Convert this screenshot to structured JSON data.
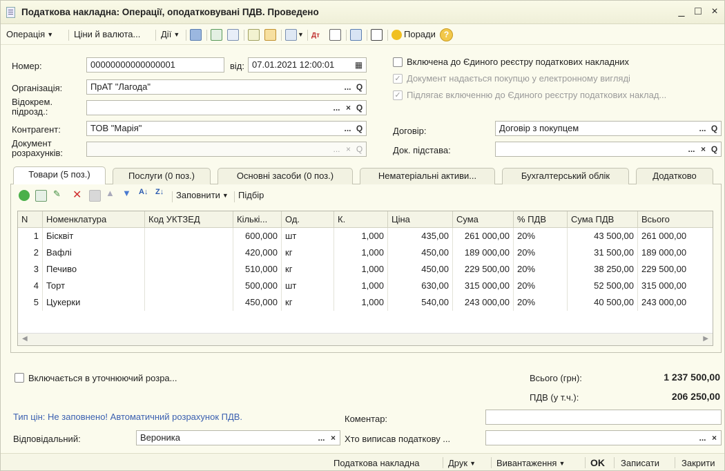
{
  "window": {
    "title": "Податкова накладна: Операції, оподатковувані ПДВ. Проведено",
    "minimize": "_",
    "maximize": "□",
    "close": "×"
  },
  "toolbar": {
    "operation": "Операція",
    "prices": "Ціни й валюта...",
    "actions": "Дії",
    "tips": "Поради",
    "help": "?"
  },
  "form": {
    "number_label": "Номер:",
    "number_value": "00000000000000001",
    "date_label": "від:",
    "date_value": "07.01.2021 12:00:01",
    "org_label": "Організація:",
    "org_value": "ПрАТ \"Лагода\"",
    "division_label": "Відокрем. підрозд.:",
    "division_value": "",
    "counterparty_label": "Контрагент:",
    "counterparty_value": "ТОВ \"Марія\"",
    "settlement_label": "Документ розрахунків:",
    "settlement_value": "",
    "reg_check_label": "Включена до Єдиного реєстру податкових накладних",
    "electronic_label": "Документ надається покупцю у електронному вигляді",
    "subject_label": "Підлягає включенню до Єдиного реєстру податкових наклад...",
    "contract_label": "Договір:",
    "contract_value": "Договір з покупцем",
    "basis_label": "Док. підстава:",
    "basis_value": ""
  },
  "tabs": [
    {
      "label": "Товари (5 поз.)"
    },
    {
      "label": "Послуги (0 поз.)"
    },
    {
      "label": "Основні засоби (0 поз.)"
    },
    {
      "label": "Нематеріальні активи..."
    },
    {
      "label": "Бухгалтерський облік"
    },
    {
      "label": "Додатково"
    }
  ],
  "grid_toolbar": {
    "fill": "Заповнити",
    "select": "Підбір"
  },
  "grid": {
    "columns": [
      "N",
      "Номенклатура",
      "Код УКТЗЕД",
      "Кількі...",
      "Од.",
      "К.",
      "Ціна",
      "Сума",
      "% ПДВ",
      "Сума ПДВ",
      "Всього"
    ],
    "rows": [
      [
        "1",
        "Бісквіт",
        "",
        "600,000",
        "шт",
        "1,000",
        "435,00",
        "261 000,00",
        "20%",
        "43 500,00",
        "261 000,00"
      ],
      [
        "2",
        "Вафлі",
        "",
        "420,000",
        "кг",
        "1,000",
        "450,00",
        "189 000,00",
        "20%",
        "31 500,00",
        "189 000,00"
      ],
      [
        "3",
        "Печиво",
        "",
        "510,000",
        "кг",
        "1,000",
        "450,00",
        "229 500,00",
        "20%",
        "38 250,00",
        "229 500,00"
      ],
      [
        "4",
        "Торт",
        "",
        "500,000",
        "шт",
        "1,000",
        "630,00",
        "315 000,00",
        "20%",
        "52 500,00",
        "315 000,00"
      ],
      [
        "5",
        "Цукерки",
        "",
        "450,000",
        "кг",
        "1,000",
        "540,00",
        "243 000,00",
        "20%",
        "40 500,00",
        "243 000,00"
      ]
    ]
  },
  "footer": {
    "clarify_label": "Включається в уточнюючий розра...",
    "total_label": "Всього (грн):",
    "total_value": "1 237 500,00",
    "vat_label": "ПДВ (у т.ч.):",
    "vat_value": "206 250,00",
    "price_type_note": "Тип цін: Не заповнено! Автоматичний розрахунок ПДВ.",
    "comment_label": "Коментар:",
    "comment_value": "",
    "responsible_label": "Відповідальний:",
    "responsible_value": "Вероника",
    "author_label": "Хто виписав податкову ...",
    "author_value": ""
  },
  "bottombar": {
    "tax_invoice": "Податкова накладна",
    "print": "Друк",
    "export": "Вивантаження",
    "ok": "OK",
    "save": "Записати",
    "close": "Закрити"
  },
  "colors": {
    "background": "#fbfbed",
    "link_blue": "#3a5fb0",
    "accent_yellow": "#f0c020"
  }
}
